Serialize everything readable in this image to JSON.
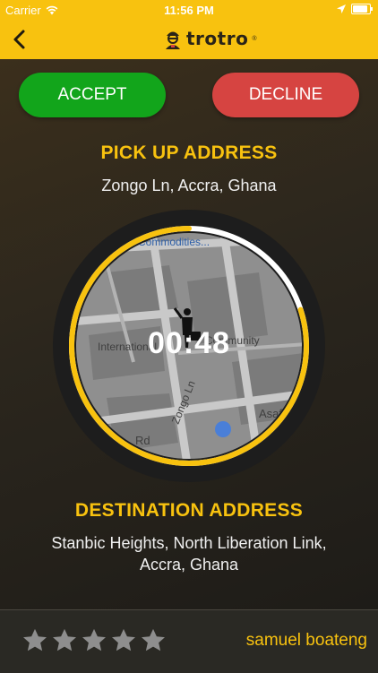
{
  "status_bar": {
    "carrier": "Carrier",
    "time": "11:56 PM"
  },
  "nav": {
    "logo_text": "trotro",
    "logo_mark": "®"
  },
  "actions": {
    "accept_label": "ACCEPT",
    "decline_label": "DECLINE"
  },
  "pickup": {
    "heading": "PICK UP ADDRESS",
    "address": "Zongo Ln,  Accra,  Ghana"
  },
  "timer": {
    "value": "00:48",
    "progress": 0.8
  },
  "map": {
    "labels": [
      "Commodities...",
      "Community",
      "International",
      "Zongo Ln",
      "Asaf",
      "Rd"
    ]
  },
  "destination": {
    "heading": "DESTINATION ADDRESS",
    "address_line1": "Stanbic Heights, North Liberation Link,",
    "address_line2": "Accra, Ghana"
  },
  "driver": {
    "name": "samuel boateng",
    "rating": 0,
    "max_rating": 5
  },
  "colors": {
    "brand_yellow": "#f8c20f",
    "accept_green": "#12a51b",
    "decline_red": "#d64441"
  }
}
